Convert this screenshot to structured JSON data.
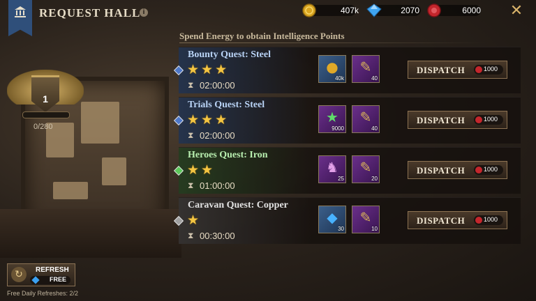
{
  "header": {
    "title": "REQUEST HALL",
    "info": "i",
    "resources": [
      {
        "name": "gold",
        "value": "407k",
        "icon": "gold-coin-icon"
      },
      {
        "name": "gems",
        "value": "2070",
        "icon": "blue-gem-icon"
      },
      {
        "name": "energy",
        "value": "6000",
        "icon": "red-seal-icon"
      }
    ],
    "close": "✕"
  },
  "rank": {
    "level": "1",
    "progress": "0/280"
  },
  "subtitle": "Spend Energy to obtain Intelligence Points",
  "quests": [
    {
      "name": "Bounty Quest: Steel",
      "stars": 3,
      "time": "02:00:00",
      "accent": "#2b4a7a",
      "diamond": "#4e78c8",
      "name_color": "#b9d3f5",
      "rewards": [
        {
          "icon": "gold-coin-icon",
          "amount": "40k"
        },
        {
          "icon": "exp-scroll-icon",
          "amount": "40"
        }
      ],
      "dispatch": "DISPATCH",
      "cost": "1000"
    },
    {
      "name": "Trials Quest: Steel",
      "stars": 3,
      "time": "02:00:00",
      "accent": "#2b4a7a",
      "diamond": "#4e78c8",
      "name_color": "#b9d3f5",
      "rewards": [
        {
          "icon": "exp-star-icon",
          "amount": "9000"
        },
        {
          "icon": "exp-scroll-icon",
          "amount": "40"
        }
      ],
      "dispatch": "DISPATCH",
      "cost": "1000"
    },
    {
      "name": "Heroes Quest: Iron",
      "stars": 2,
      "time": "01:00:00",
      "accent": "#2e5a2c",
      "diamond": "#5cc85a",
      "name_color": "#b9efb0",
      "rewards": [
        {
          "icon": "hero-shard-icon",
          "amount": "25"
        },
        {
          "icon": "exp-scroll-icon",
          "amount": "20"
        }
      ],
      "dispatch": "DISPATCH",
      "cost": "1000"
    },
    {
      "name": "Caravan Quest: Copper",
      "stars": 1,
      "time": "00:30:00",
      "accent": "#4a4a4a",
      "diamond": "#a0a0a0",
      "name_color": "#e2e2e2",
      "rewards": [
        {
          "icon": "blue-gem-icon",
          "amount": "30"
        },
        {
          "icon": "exp-scroll-icon",
          "amount": "10"
        }
      ],
      "dispatch": "DISPATCH",
      "cost": "1000"
    }
  ],
  "refresh": {
    "label": "REFRESH",
    "cost": "FREE",
    "note": "Free Daily Refreshes: 2/2"
  }
}
